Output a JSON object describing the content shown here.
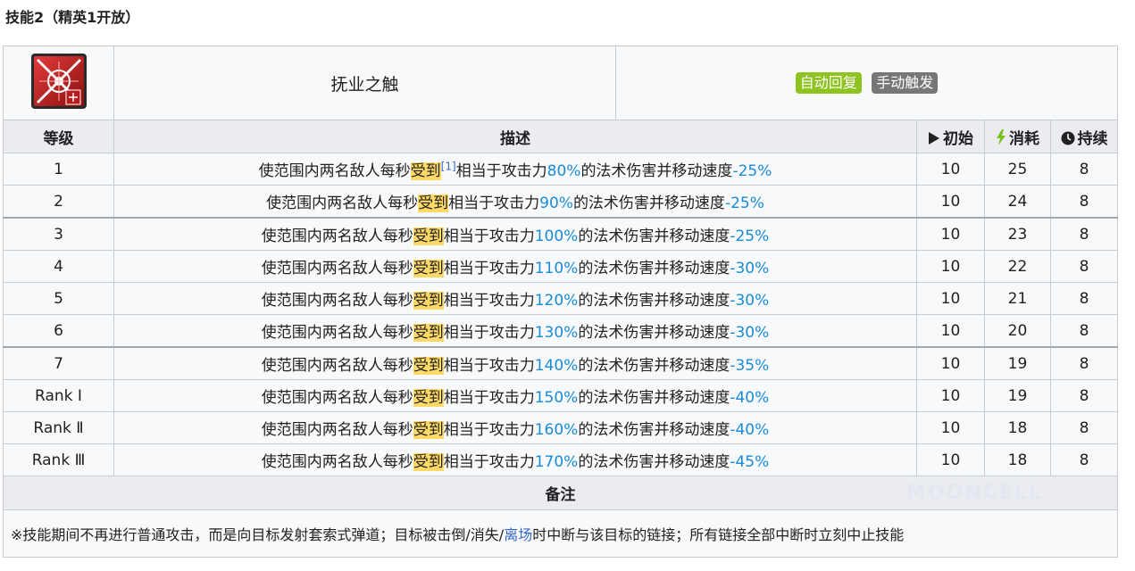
{
  "section_title": "技能2（精英1开放）",
  "skill": {
    "name": "抚业之触",
    "icon": "skill-icon",
    "badges": [
      {
        "label": "自动回复",
        "color": "#8fc31f"
      },
      {
        "label": "手动触发",
        "color": "#777777"
      }
    ]
  },
  "columns": {
    "level": "等级",
    "description": "描述",
    "initial": "初始",
    "cost": "消耗",
    "duration": "持续"
  },
  "header_icons": {
    "initial": "play-icon",
    "cost": "lightning-icon",
    "duration": "clock-icon"
  },
  "desc_parts": {
    "prefix": "使范围内两名敌人每秒",
    "highlight": "受到",
    "ref": "[1]",
    "middle": "相当于攻击力",
    "suffix": "的法术伤害并移动速度"
  },
  "levels": [
    {
      "level": "1",
      "atk": "80%",
      "slow": "-25%",
      "initial": "10",
      "cost": "25",
      "duration": "8"
    },
    {
      "level": "2",
      "atk": "90%",
      "slow": "-25%",
      "initial": "10",
      "cost": "24",
      "duration": "8"
    },
    {
      "level": "3",
      "atk": "100%",
      "slow": "-25%",
      "initial": "10",
      "cost": "23",
      "duration": "8"
    },
    {
      "level": "4",
      "atk": "110%",
      "slow": "-30%",
      "initial": "10",
      "cost": "22",
      "duration": "8"
    },
    {
      "level": "5",
      "atk": "120%",
      "slow": "-30%",
      "initial": "10",
      "cost": "21",
      "duration": "8"
    },
    {
      "level": "6",
      "atk": "130%",
      "slow": "-30%",
      "initial": "10",
      "cost": "20",
      "duration": "8"
    },
    {
      "level": "7",
      "atk": "140%",
      "slow": "-35%",
      "initial": "10",
      "cost": "19",
      "duration": "8"
    },
    {
      "level": "Rank Ⅰ",
      "atk": "150%",
      "slow": "-40%",
      "initial": "10",
      "cost": "19",
      "duration": "8"
    },
    {
      "level": "Rank Ⅱ",
      "atk": "160%",
      "slow": "-40%",
      "initial": "10",
      "cost": "18",
      "duration": "8"
    },
    {
      "level": "Rank Ⅲ",
      "atk": "170%",
      "slow": "-45%",
      "initial": "10",
      "cost": "18",
      "duration": "8"
    }
  ],
  "note": {
    "title": "备注",
    "text_before_link": "※技能期间不再进行普通攻击，而是向目标发射套索式弹道；目标被击倒/消失/",
    "link_text": "离场",
    "text_after_link": "时中断与该目标的链接；所有链接全部中断时立刻中止技能"
  },
  "watermark": "MOONCELL"
}
